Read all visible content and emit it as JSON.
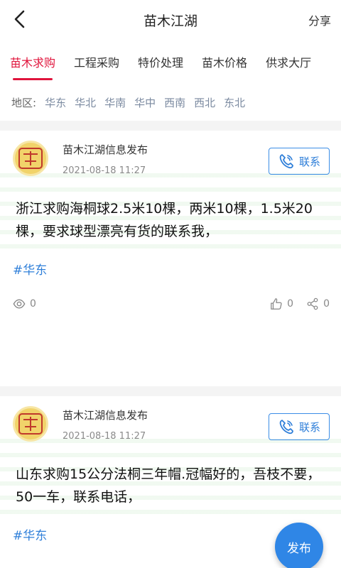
{
  "header": {
    "title": "苗木江湖",
    "share_label": "分享"
  },
  "tabs": [
    "苗木求购",
    "工程采购",
    "特价处理",
    "苗木价格",
    "供求大厅"
  ],
  "region": {
    "label": "地区:",
    "items": [
      "华东",
      "华北",
      "华南",
      "华中",
      "西南",
      "西北",
      "东北"
    ]
  },
  "posts": [
    {
      "author": "苗木江湖信息发布",
      "time": "2021-08-18 11:27",
      "contact_label": "联系",
      "content": "浙江求购海桐球2.5米10棵，两米10棵，1.5米20棵，要求球型漂亮有货的联系我，",
      "tag": "#华东",
      "views": "0",
      "likes": "0",
      "shares": "0"
    },
    {
      "author": "苗木江湖信息发布",
      "time": "2021-08-18 11:27",
      "contact_label": "联系",
      "content": "山东求购15公分法桐三年帽.冠幅好的，吾枝不要，50一车，联系电话，",
      "tag": "#华东"
    }
  ],
  "fab_label": "发布",
  "colors": {
    "accent": "#e0143c",
    "link": "#2f7fd9"
  }
}
